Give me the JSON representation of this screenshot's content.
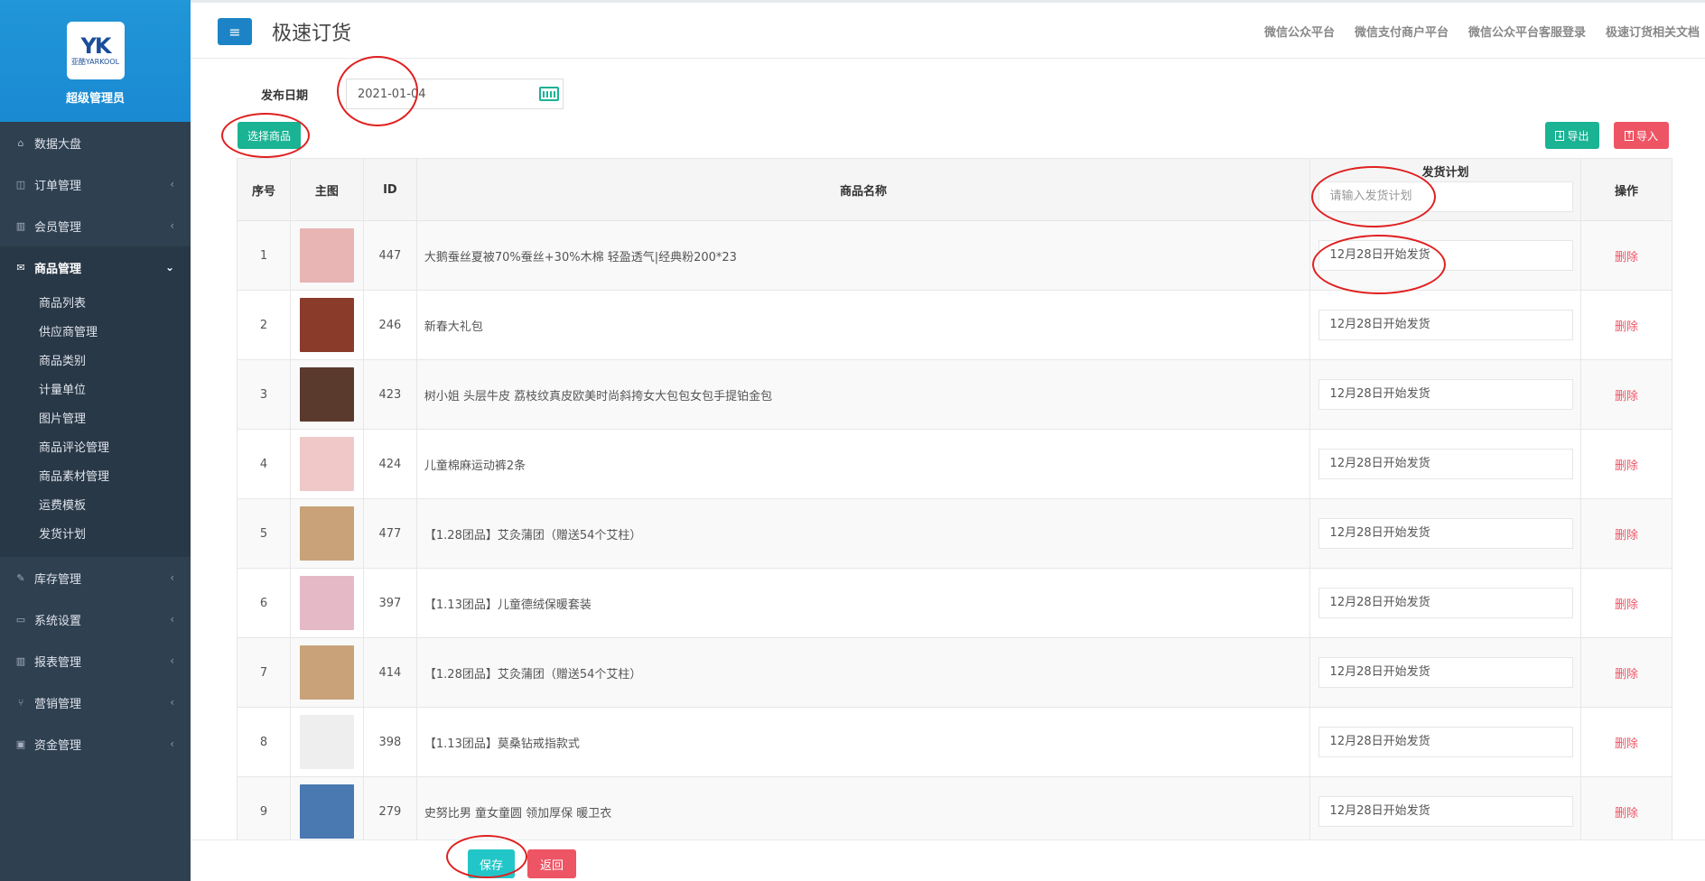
{
  "sidebar": {
    "logo_mark": "YK",
    "logo_sub": "亚酷YARKOOL",
    "role": "超级管理员",
    "items": [
      {
        "label": "数据大盘",
        "icon": "home-icon",
        "glyph": "⌂"
      },
      {
        "label": "订单管理",
        "icon": "columns-icon",
        "glyph": "◫",
        "chev": "‹"
      },
      {
        "label": "会员管理",
        "icon": "bar-chart-icon",
        "glyph": "▥",
        "chev": "‹"
      },
      {
        "label": "商品管理",
        "icon": "envelope-icon",
        "glyph": "✉",
        "chev": "⌄"
      },
      {
        "label": "库存管理",
        "icon": "edit-icon",
        "glyph": "✎",
        "chev": "‹"
      },
      {
        "label": "系统设置",
        "icon": "desktop-icon",
        "glyph": "▭",
        "chev": "‹"
      },
      {
        "label": "报表管理",
        "icon": "bar-chart-icon",
        "glyph": "▥",
        "chev": "‹"
      },
      {
        "label": "营销管理",
        "icon": "cutlery-icon",
        "glyph": "⑂",
        "chev": "‹"
      },
      {
        "label": "资金管理",
        "icon": "money-icon",
        "glyph": "▣",
        "chev": "‹"
      }
    ],
    "sub_items": [
      "商品列表",
      "供应商管理",
      "商品类别",
      "计量单位",
      "图片管理",
      "商品评论管理",
      "商品素材管理",
      "运费模板",
      "发货计划"
    ]
  },
  "header": {
    "menu_glyph": "≡",
    "title": "极速订货",
    "links": [
      "微信公众平台",
      "微信支付商户平台",
      "微信公众平台客服登录",
      "极速订货相关文档"
    ]
  },
  "form": {
    "date_label": "发布日期",
    "date_value": "2021-01-04"
  },
  "buttons": {
    "select_goods": "选择商品",
    "export": "导出",
    "import": "导入",
    "save": "保存",
    "back": "返回"
  },
  "table": {
    "headers": {
      "index": "序号",
      "image": "主图",
      "id": "ID",
      "name": "商品名称",
      "plan": "发货计划",
      "action": "操作"
    },
    "plan_placeholder": "请输入发货计划",
    "delete_label": "删除",
    "rows": [
      {
        "index": "1",
        "id": "447",
        "name": "大鹅蚕丝夏被70%蚕丝+30%木棉 轻盈透气|经典粉200*23",
        "plan": "12月28日开始发货",
        "img_color": "#e8b4b4"
      },
      {
        "index": "2",
        "id": "246",
        "name": "新春大礼包",
        "plan": "12月28日开始发货",
        "img_color": "#8a3b2a"
      },
      {
        "index": "3",
        "id": "423",
        "name": "树小姐 头层牛皮 荔枝纹真皮欧美时尚斜挎女大包包女包手提铂金包",
        "plan": "12月28日开始发货",
        "img_color": "#5b3a2e"
      },
      {
        "index": "4",
        "id": "424",
        "name": "儿童棉麻运动裤2条",
        "plan": "12月28日开始发货",
        "img_color": "#f0c8c8"
      },
      {
        "index": "5",
        "id": "477",
        "name": "【1.28团品】艾灸蒲团（赠送54个艾柱）",
        "plan": "12月28日开始发货",
        "img_color": "#c9a27a"
      },
      {
        "index": "6",
        "id": "397",
        "name": "【1.13团品】儿童德绒保暖套装",
        "plan": "12月28日开始发货",
        "img_color": "#e6b9c6"
      },
      {
        "index": "7",
        "id": "414",
        "name": "【1.28团品】艾灸蒲团（赠送54个艾柱）",
        "plan": "12月28日开始发货",
        "img_color": "#c9a27a"
      },
      {
        "index": "8",
        "id": "398",
        "name": "【1.13团品】莫桑钻戒指款式",
        "plan": "12月28日开始发货",
        "img_color": "#eeeeee"
      },
      {
        "index": "9",
        "id": "279",
        "name": "史努比男 童女童圆 领加厚保 暖卫衣",
        "plan": "12月28日开始发货",
        "img_color": "#4a78b0"
      }
    ]
  }
}
